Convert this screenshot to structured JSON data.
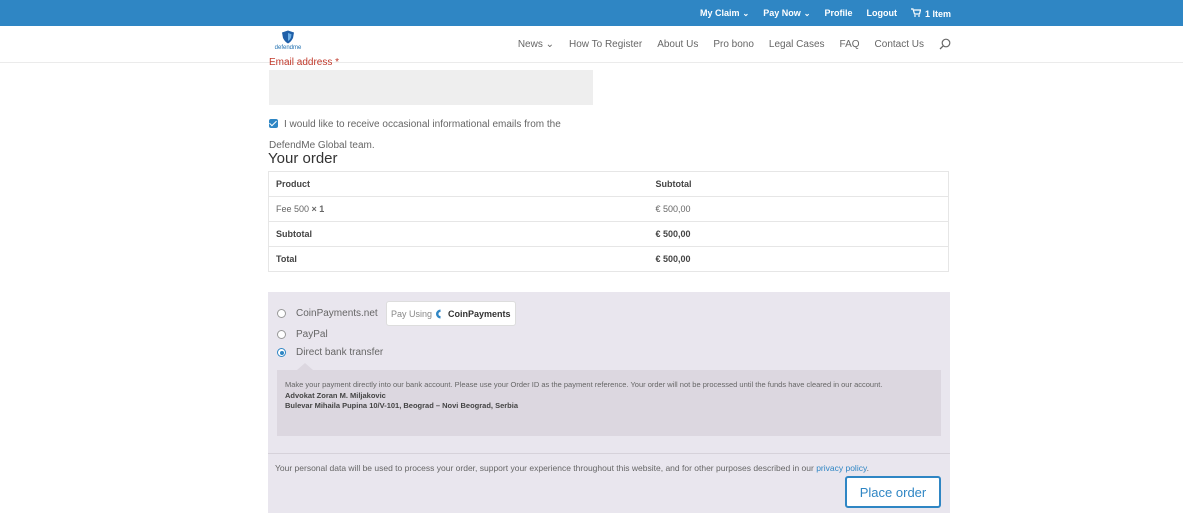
{
  "topbar": {
    "my_claim": "My Claim",
    "pay_now": "Pay Now",
    "profile": "Profile",
    "logout": "Logout",
    "cart": "1 Item",
    "bg_color": "#2f86c4"
  },
  "header": {
    "logo_text": "defendme",
    "nav": {
      "news": "News",
      "how_to_register": "How To Register",
      "about_us": "About Us",
      "pro_bono": "Pro bono",
      "legal_cases": "Legal Cases",
      "faq": "FAQ",
      "contact_us": "Contact Us"
    }
  },
  "form": {
    "email_label": "Email address",
    "required_mark": "*",
    "email_value": "",
    "newsletter_label": "I would like to receive occasional informational emails from the DefendMe Global team.",
    "newsletter_checked": true
  },
  "order": {
    "title": "Your order",
    "headers": {
      "product": "Product",
      "subtotal": "Subtotal"
    },
    "item": {
      "name": "Fee 500",
      "qty": "× 1",
      "subtotal": "€ 500,00"
    },
    "subtotal_row": {
      "label": "Subtotal",
      "value": "€ 500,00"
    },
    "total_row": {
      "label": "Total",
      "value": "€ 500,00"
    }
  },
  "payment": {
    "methods": {
      "coinpayments": "CoinPayments.net",
      "paypal": "PayPal",
      "bank": "Direct bank transfer"
    },
    "selected": "bank",
    "coin_badge": {
      "prefix": "Pay Using",
      "brand": "CoinPayments"
    },
    "bank_description": "Make your payment directly into our bank account. Please use your Order ID as the payment reference. Your order will not be processed until the funds have cleared in our account.",
    "bank_name": "Advokat Zoran M. Miljakovic",
    "bank_address": "Bulevar Mihaila Pupina 10/V-101, Beograd – Novi Beograd, Serbia",
    "privacy_text": "Your personal data will be used to process your order, support your experience throughout this website, and for other purposes described in our",
    "privacy_link": "privacy policy",
    "privacy_end": ".",
    "place_order": "Place order"
  }
}
